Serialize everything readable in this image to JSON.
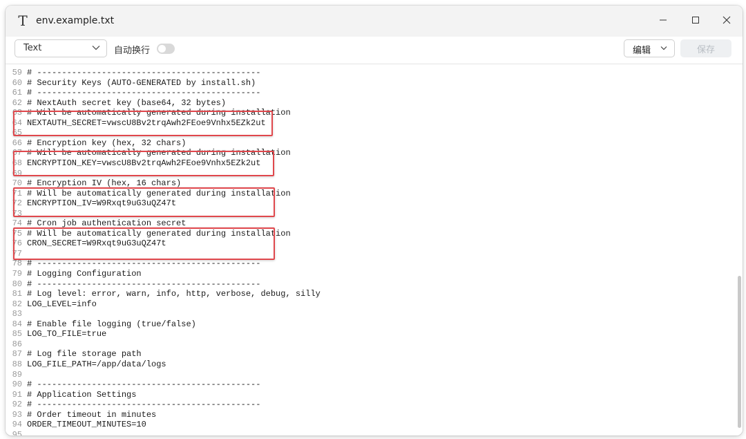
{
  "window": {
    "title": "env.example.txt",
    "app_icon_glyph": "T"
  },
  "toolbar": {
    "language": "Text",
    "word_wrap_label": "自动换行",
    "word_wrap_enabled": false,
    "edit_label": "编辑",
    "save_label": "保存"
  },
  "icons": {
    "app": "text-file-icon",
    "minimize": "minimize-icon",
    "maximize": "maximize-icon",
    "close": "close-icon",
    "dropdown": "chevron-down-icon"
  },
  "colors": {
    "highlight_box": "#e0474c",
    "save_disabled_text": "#b9bec4",
    "line_number": "#9a9a9a"
  },
  "editor": {
    "lines": [
      {
        "n": "59",
        "text": "# ---------------------------------------------"
      },
      {
        "n": "60",
        "text": "# Security Keys (AUTO-GENERATED by install.sh)"
      },
      {
        "n": "61",
        "text": "# ---------------------------------------------"
      },
      {
        "n": "62",
        "text": "# NextAuth secret key (base64, 32 bytes)"
      },
      {
        "n": "63",
        "text": "# Will be automatically generated during installation"
      },
      {
        "n": "64",
        "text": "NEXTAUTH_SECRET=vwscU8Bv2trqAwh2FEoe9Vnhx5EZk2ut"
      },
      {
        "n": "65",
        "text": ""
      },
      {
        "n": "66",
        "text": "# Encryption key (hex, 32 chars)"
      },
      {
        "n": "67",
        "text": "# Will be automatically generated during installation"
      },
      {
        "n": "68",
        "text": "ENCRYPTION_KEY=vwscU8Bv2trqAwh2FEoe9Vnhx5EZk2ut"
      },
      {
        "n": "69",
        "text": ""
      },
      {
        "n": "70",
        "text": "# Encryption IV (hex, 16 chars)"
      },
      {
        "n": "71",
        "text": "# Will be automatically generated during installation"
      },
      {
        "n": "72",
        "text": "ENCRYPTION_IV=W9Rxqt9uG3uQZ47t"
      },
      {
        "n": "73",
        "text": ""
      },
      {
        "n": "74",
        "text": "# Cron job authentication secret"
      },
      {
        "n": "75",
        "text": "# Will be automatically generated during installation"
      },
      {
        "n": "76",
        "text": "CRON_SECRET=W9Rxqt9uG3uQZ47t"
      },
      {
        "n": "77",
        "text": ""
      },
      {
        "n": "78",
        "text": "# ---------------------------------------------"
      },
      {
        "n": "79",
        "text": "# Logging Configuration"
      },
      {
        "n": "80",
        "text": "# ---------------------------------------------"
      },
      {
        "n": "81",
        "text": "# Log level: error, warn, info, http, verbose, debug, silly"
      },
      {
        "n": "82",
        "text": "LOG_LEVEL=info"
      },
      {
        "n": "83",
        "text": ""
      },
      {
        "n": "84",
        "text": "# Enable file logging (true/false)"
      },
      {
        "n": "85",
        "text": "LOG_TO_FILE=true"
      },
      {
        "n": "86",
        "text": ""
      },
      {
        "n": "87",
        "text": "# Log file storage path"
      },
      {
        "n": "88",
        "text": "LOG_FILE_PATH=/app/data/logs"
      },
      {
        "n": "89",
        "text": ""
      },
      {
        "n": "90",
        "text": "# ---------------------------------------------"
      },
      {
        "n": "91",
        "text": "# Application Settings"
      },
      {
        "n": "92",
        "text": "# ---------------------------------------------"
      },
      {
        "n": "93",
        "text": "# Order timeout in minutes"
      },
      {
        "n": "94",
        "text": "ORDER_TIMEOUT_MINUTES=10"
      },
      {
        "n": "95",
        "text": ""
      }
    ]
  }
}
